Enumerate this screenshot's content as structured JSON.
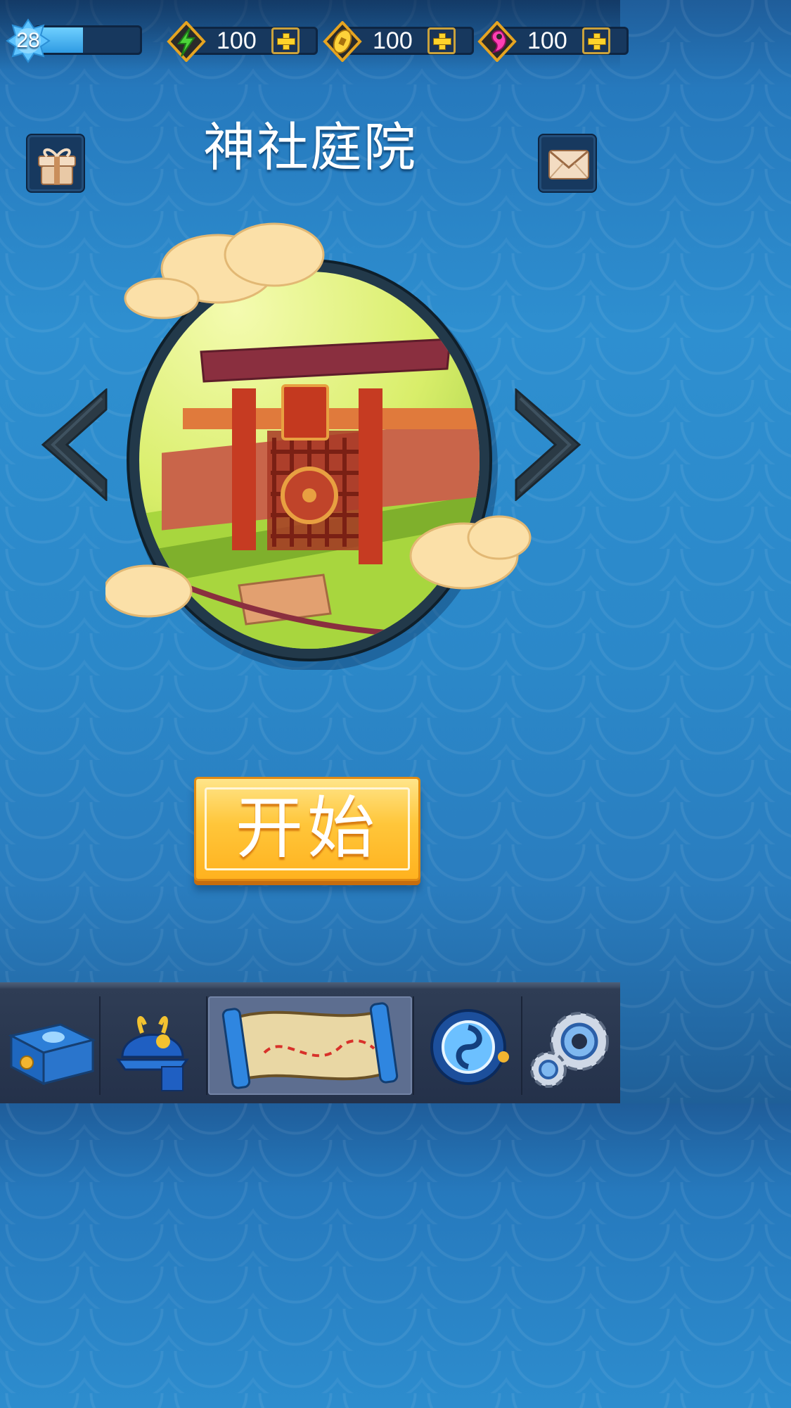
{
  "player": {
    "level": "28",
    "xp_progress": 0.45
  },
  "resources": [
    {
      "name": "energy",
      "icon": "lightning-icon",
      "value": "100"
    },
    {
      "name": "coins",
      "icon": "gold-coin-icon",
      "value": "100"
    },
    {
      "name": "gems",
      "icon": "magatama-icon",
      "value": "100"
    }
  ],
  "stage": {
    "title": "神社庭院"
  },
  "start_button": {
    "label": "开始"
  },
  "dock": [
    {
      "name": "treasure-chest",
      "icon": "treasure-chest-icon",
      "active": false
    },
    {
      "name": "samurai-helmet",
      "icon": "samurai-helmet-icon",
      "active": false
    },
    {
      "name": "map-scroll",
      "icon": "map-scroll-icon",
      "active": true
    },
    {
      "name": "tomoe-orb",
      "icon": "tomoe-orb-icon",
      "active": false
    },
    {
      "name": "settings",
      "icon": "gear-icon",
      "active": false
    }
  ],
  "colors": {
    "background": "#2b88c9",
    "accent": "#ffc63a",
    "panel": "#17385e"
  }
}
